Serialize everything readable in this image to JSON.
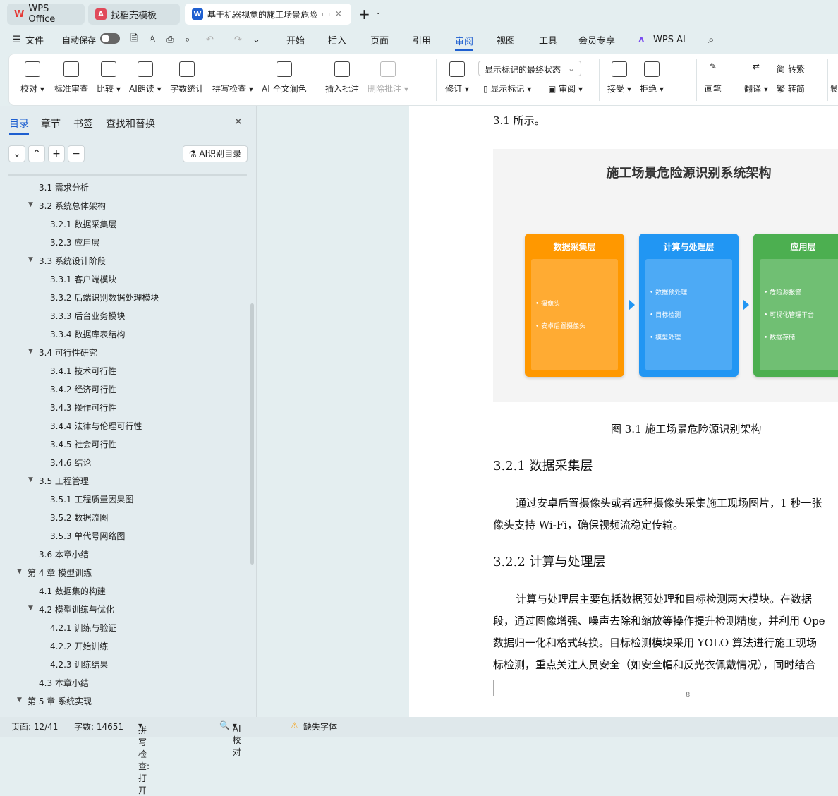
{
  "tabs": [
    {
      "label": "WPS Office"
    },
    {
      "label": "找稻壳模板"
    },
    {
      "label": "基于机器视觉的施工场景危险"
    }
  ],
  "menu": {
    "file": "文件",
    "autosave": "自动保存",
    "items": [
      "开始",
      "插入",
      "页面",
      "引用",
      "审阅",
      "视图",
      "工具",
      "会员专享"
    ],
    "active": "审阅",
    "wps_ai": "WPS AI"
  },
  "ribbon": {
    "buttons": [
      "校对",
      "标准审查",
      "比较",
      "AI朗读",
      "字数统计",
      "拼写检查",
      "AI 全文润色",
      "插入批注",
      "删除批注",
      "修订",
      "接受",
      "拒绝",
      "画笔",
      "翻译",
      "限"
    ],
    "markup_select": "显示标记的最终状态",
    "show_markup": "显示标记",
    "review": "审阅",
    "to_trad": "转繁",
    "to_simp": "转简"
  },
  "sidebar": {
    "tabs": [
      "目录",
      "章节",
      "书签",
      "查找和替换"
    ],
    "ai_toc": "AI识别目录",
    "toc": [
      {
        "label": "3.1 需求分析",
        "level": 2,
        "expanded": null
      },
      {
        "label": "3.2 系统总体架构",
        "level": 2,
        "expanded": true
      },
      {
        "label": "3.2.1 数据采集层",
        "level": 3
      },
      {
        "label": "3.2.3 应用层",
        "level": 3
      },
      {
        "label": "3.3 系统设计阶段",
        "level": 2,
        "expanded": true
      },
      {
        "label": "3.3.1 客户端模块",
        "level": 3
      },
      {
        "label": "3.3.2 后端识别数据处理模块",
        "level": 3
      },
      {
        "label": "3.3.3 后台业务模块",
        "level": 3
      },
      {
        "label": "3.3.4 数据库表结构",
        "level": 3
      },
      {
        "label": "3.4 可行性研究",
        "level": 2,
        "expanded": true
      },
      {
        "label": "3.4.1 技术可行性",
        "level": 3
      },
      {
        "label": "3.4.2 经济可行性",
        "level": 3
      },
      {
        "label": "3.4.3 操作可行性",
        "level": 3
      },
      {
        "label": "3.4.4 法律与伦理可行性",
        "level": 3
      },
      {
        "label": "3.4.5 社会可行性",
        "level": 3
      },
      {
        "label": "3.4.6 结论",
        "level": 3
      },
      {
        "label": "3.5 工程管理",
        "level": 2,
        "expanded": true
      },
      {
        "label": "3.5.1 工程质量因果图",
        "level": 3
      },
      {
        "label": "3.5.2 数据流图",
        "level": 3
      },
      {
        "label": "3.5.3 单代号网络图",
        "level": 3
      },
      {
        "label": "3.6 本章小结",
        "level": 2
      },
      {
        "label": "第 4 章  模型训练",
        "level": 1,
        "expanded": true
      },
      {
        "label": "4.1 数据集的构建",
        "level": 2
      },
      {
        "label": "4.2 模型训练与优化",
        "level": 2,
        "expanded": true
      },
      {
        "label": "4.2.1 训练与验证",
        "level": 3
      },
      {
        "label": "4.2.2 开始训练",
        "level": 3
      },
      {
        "label": "4.2.3 训练结果",
        "level": 3
      },
      {
        "label": "4.3 本章小结",
        "level": 2
      },
      {
        "label": "第 5 章  系统实现",
        "level": 1,
        "expanded": true
      }
    ]
  },
  "document": {
    "intro": "3.1 所示。",
    "figure": {
      "title": "施工场景危险源识别系统架构",
      "columns": [
        {
          "title": "数据采集层",
          "items": [
            "摄像头",
            "安卓后置摄像头"
          ],
          "color": "#ff9800",
          "inner": "#ffab33"
        },
        {
          "title": "计算与处理层",
          "items": [
            "数据预处理",
            "目标检测",
            "模型处理"
          ],
          "color": "#2196f3",
          "inner": "#4daaf5"
        },
        {
          "title": "应用层",
          "items": [
            "危险源报警",
            "可视化管理平台",
            "数据存储"
          ],
          "color": "#4caf50",
          "inner": "#70bf73"
        }
      ]
    },
    "caption": "图 3.1 施工场景危险源识别架构",
    "h1": "3.2.1 数据采集层",
    "p1": [
      "通过安卓后置摄像头或者远程摄像头采集施工现场图片，1 秒一张",
      "像头支持 Wi-Fi，确保视频流稳定传输。"
    ],
    "h2": "3.2.2 计算与处理层",
    "p2": [
      "计算与处理层主要包括数据预处理和目标检测两大模块。在数据",
      "段，通过图像增强、噪声去除和缩放等操作提升检测精度，并利用 Ope",
      "数据归一化和格式转换。目标检测模块采用 YOLO 算法进行施工现场",
      "标检测，重点关注人员安全（如安全帽和反光衣佩戴情况），同时结合"
    ],
    "page_number": "8"
  },
  "status": {
    "page": "页面: 12/41",
    "words": "字数: 14651",
    "spell": "拼写检查: 打开",
    "ai_check": "AI 校对",
    "missing_font": "缺失字体"
  },
  "colors": {
    "accent": "#1e5fd0",
    "background": "#e4eef0"
  }
}
